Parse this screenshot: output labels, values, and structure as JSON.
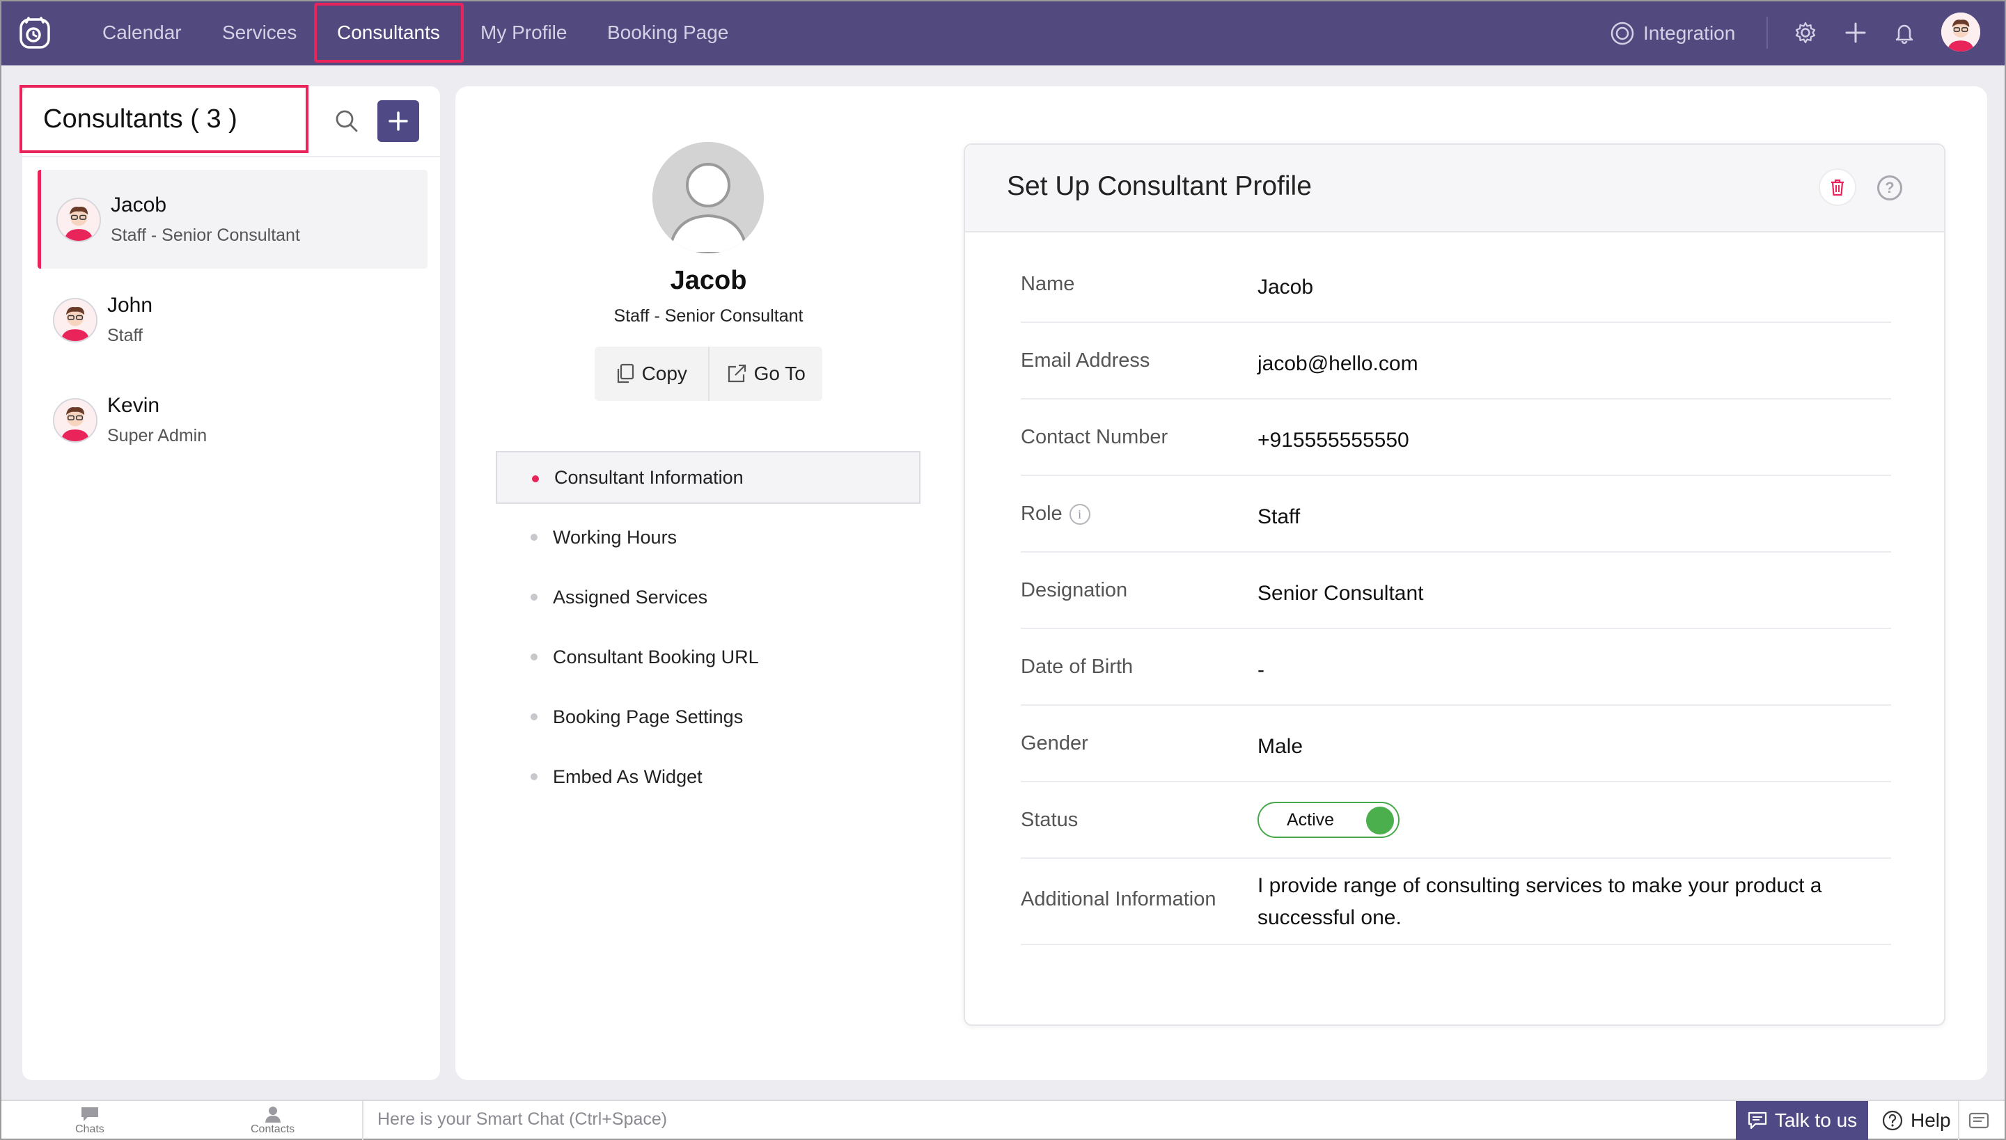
{
  "nav": {
    "items": [
      {
        "label": "Calendar"
      },
      {
        "label": "Services"
      },
      {
        "label": "Consultants"
      },
      {
        "label": "My Profile"
      },
      {
        "label": "Booking Page"
      }
    ],
    "active": "Consultants",
    "integration_label": "Integration"
  },
  "sidebar": {
    "title": "Consultants ( 3 )",
    "consultants": [
      {
        "name": "Jacob",
        "role": "Staff - Senior Consultant"
      },
      {
        "name": "John",
        "role": "Staff"
      },
      {
        "name": "Kevin",
        "role": "Super Admin"
      }
    ]
  },
  "profile": {
    "name": "Jacob",
    "role": "Staff - Senior Consultant",
    "copy_label": "Copy",
    "goto_label": "Go To",
    "menu": [
      {
        "label": "Consultant Information"
      },
      {
        "label": "Working Hours"
      },
      {
        "label": "Assigned Services"
      },
      {
        "label": "Consultant Booking URL"
      },
      {
        "label": "Booking Page Settings"
      },
      {
        "label": "Embed As Widget"
      }
    ]
  },
  "card": {
    "title": "Set Up Consultant Profile",
    "help_glyph": "?",
    "fields": [
      {
        "label": "Name",
        "value": "Jacob"
      },
      {
        "label": "Email Address",
        "value": "jacob@hello.com"
      },
      {
        "label": "Contact Number",
        "value": "+915555555550"
      },
      {
        "label": "Role",
        "value": "Staff"
      },
      {
        "label": "Designation",
        "value": "Senior Consultant"
      },
      {
        "label": "Date of Birth",
        "value": "-"
      },
      {
        "label": "Gender",
        "value": "Male"
      },
      {
        "label": "Status",
        "value": "Active"
      },
      {
        "label": "Additional Information",
        "value": "I provide range of consulting services to make your product a successful one."
      }
    ]
  },
  "bottom": {
    "chats_label": "Chats",
    "contacts_label": "Contacts",
    "chat_placeholder": "Here is your Smart Chat (Ctrl+Space)",
    "talk_label": "Talk to us",
    "help_label": "Help"
  },
  "colors": {
    "topbar": "#524a7f",
    "accent": "#e8245a",
    "primary_button": "#4f4a86",
    "status_active": "#4aaf4c"
  },
  "icons": [
    "app-logo-icon",
    "integration-icon",
    "gear-icon",
    "plus-icon",
    "bell-icon",
    "search-icon",
    "copy-icon",
    "external-link-icon",
    "trash-icon",
    "help-icon",
    "info-icon",
    "chat-bubble-icon",
    "contacts-icon"
  ]
}
